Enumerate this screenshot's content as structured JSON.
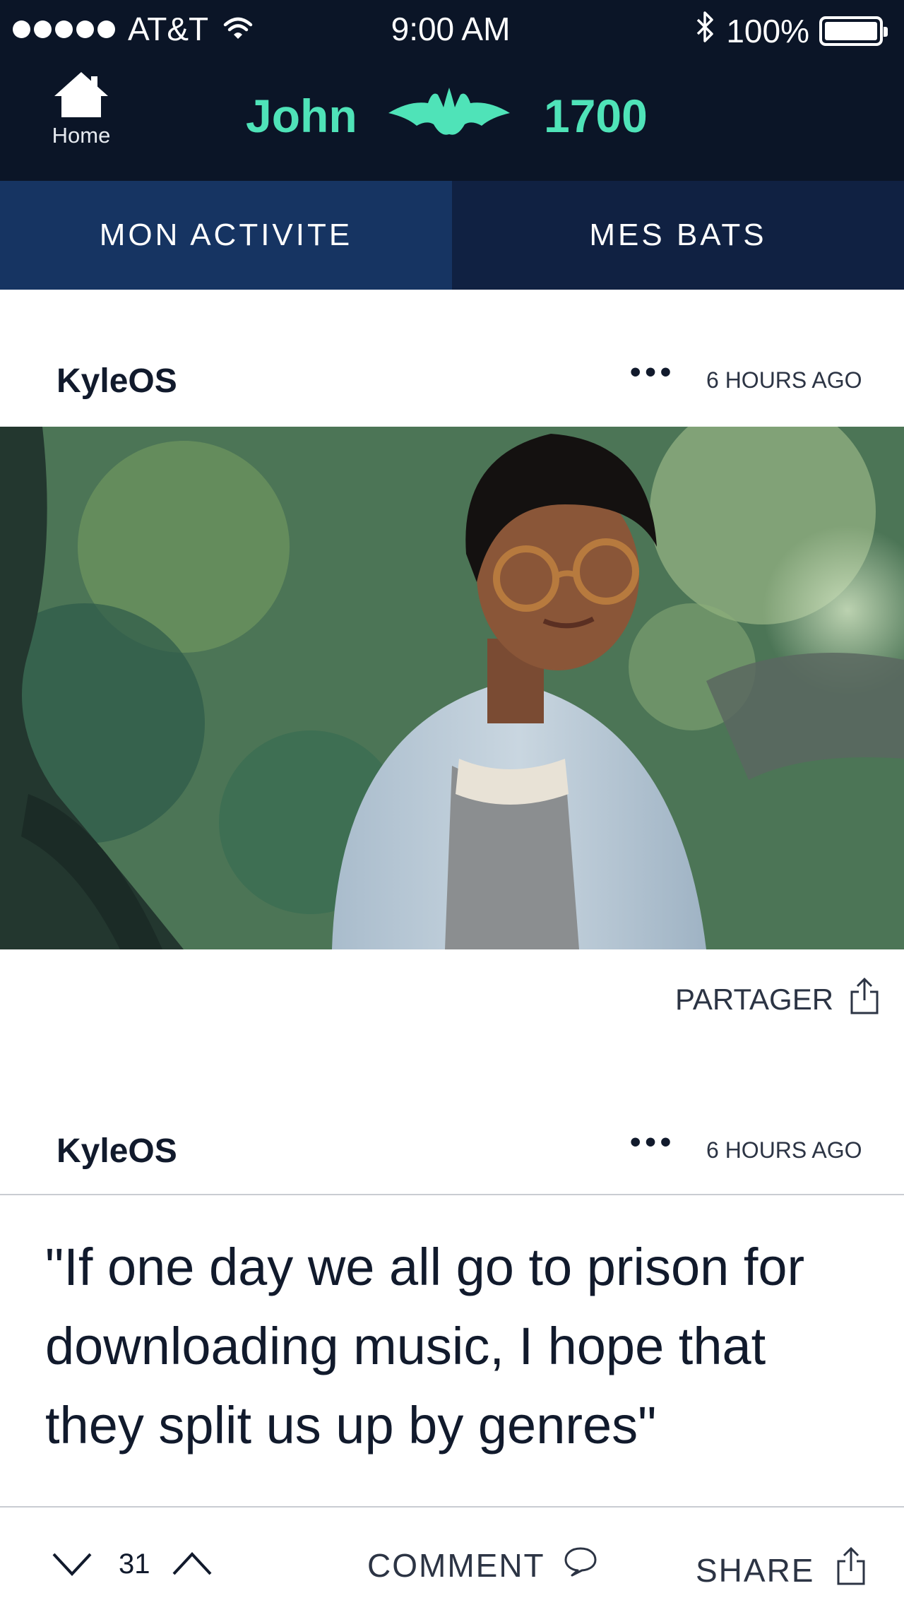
{
  "status_bar": {
    "carrier": "AT&T",
    "time": "9:00 AM",
    "battery": "100%",
    "signal_bars": 5
  },
  "header": {
    "home_label": "Home",
    "user_name": "John",
    "points": "1700"
  },
  "tabs": [
    {
      "label": "MON ACTIVITE",
      "active": true
    },
    {
      "label": "MES BATS",
      "active": false
    }
  ],
  "posts": [
    {
      "author": "KyleOS",
      "more": "•••",
      "time_ago": "6 HOURS AGO",
      "share_label": "PARTAGER"
    },
    {
      "author": "KyleOS",
      "more": "•••",
      "time_ago": "6 HOURS AGO",
      "quote": "\"If one day we all go to prison for downloading music, I hope that  they split us up by genres\"",
      "vote_count": "31",
      "comment_label": "COMMENT",
      "share_label": "SHARE"
    }
  ],
  "colors": {
    "header_bg": "#0b1527",
    "accent": "#4fe3b8",
    "tab_active": "#163462",
    "tab_inactive": "#102142"
  },
  "icons": [
    "wifi-icon",
    "bluetooth-icon",
    "battery-icon",
    "home-icon",
    "bat-logo-icon",
    "share-icon",
    "comment-icon",
    "chevron-down-icon",
    "chevron-up-icon"
  ]
}
